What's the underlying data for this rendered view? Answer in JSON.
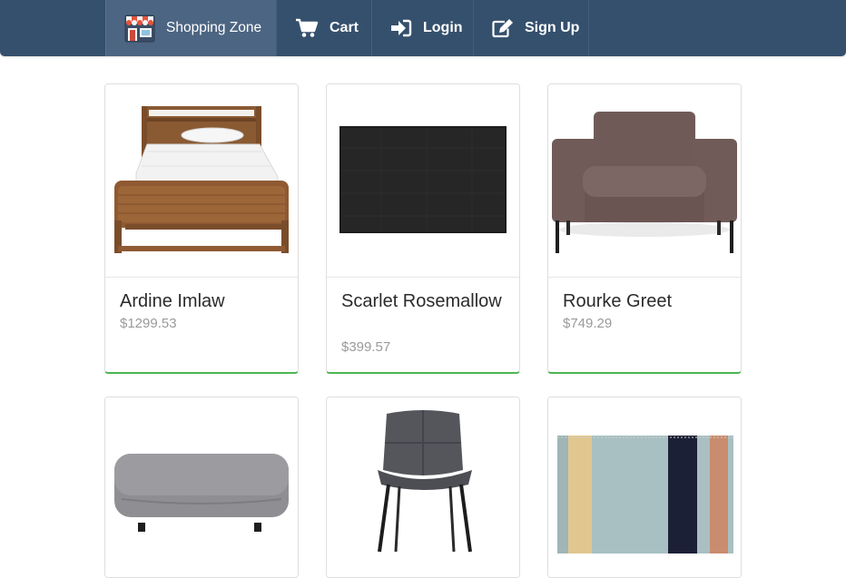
{
  "navbar": {
    "brand": {
      "label": "Shopping Zone",
      "icon": "store-icon"
    },
    "items": [
      {
        "label": "Cart",
        "icon": "cart-icon"
      },
      {
        "label": "Login",
        "icon": "login-icon"
      },
      {
        "label": "Sign Up",
        "icon": "signup-icon"
      }
    ]
  },
  "products": [
    {
      "name": "Ardine Imlaw",
      "price": "$1299.53",
      "image": "bed"
    },
    {
      "name": "Scarlet Rosemallow",
      "price": "$399.57",
      "image": "rug"
    },
    {
      "name": "Rourke Greet",
      "price": "$749.29",
      "image": "armchair"
    },
    {
      "name": "",
      "price": "",
      "image": "ottoman"
    },
    {
      "name": "",
      "price": "",
      "image": "chair"
    },
    {
      "name": "",
      "price": "",
      "image": "striped-rug"
    }
  ],
  "colors": {
    "navbar": "#35506d",
    "navbar_active": "#4c6582",
    "card_accent": "#4cb652",
    "price_text": "#9a9a9a"
  }
}
